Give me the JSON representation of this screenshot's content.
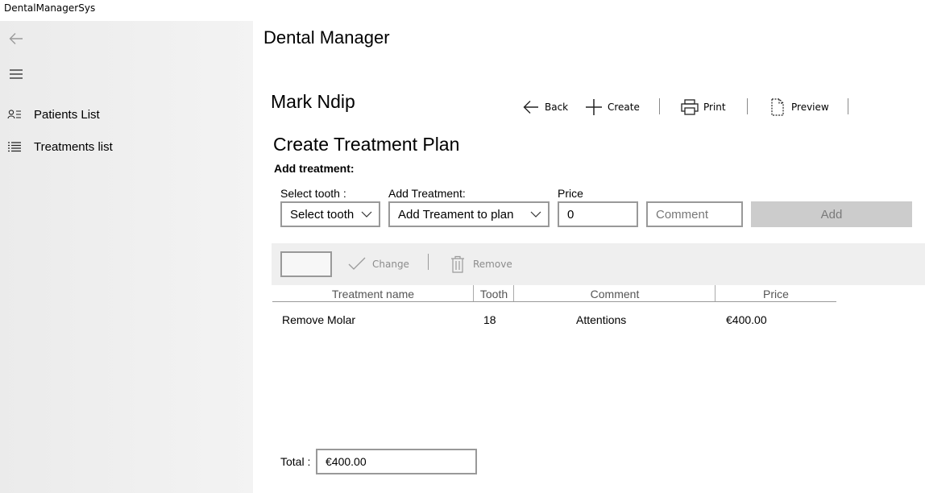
{
  "window": {
    "title": "DentalManagerSys"
  },
  "nav": {
    "back_icon": "arrow-left-icon",
    "menu_icon": "hamburger-icon",
    "items": [
      {
        "label": "Patients List",
        "icon": "contact-list-icon"
      },
      {
        "label": "Treatments list",
        "icon": "bulleted-list-icon"
      }
    ]
  },
  "header": {
    "app_title": "Dental Manager",
    "patient_name": "Mark Ndip"
  },
  "commands": {
    "back": "Back",
    "create": "Create",
    "print": "Print",
    "preview": "Preview"
  },
  "form": {
    "section_title": "Create Treatment Plan",
    "subtitle": "Add treatment:",
    "tooth_label": "Select tooth :",
    "tooth_value": "Select tooth",
    "treatment_label": "Add Treatment:",
    "treatment_value": "Add Treament to plan",
    "price_label": "Price",
    "price_value": "0",
    "comment_placeholder": "Comment",
    "add_label": "Add"
  },
  "grid_toolbar": {
    "change_label": "Change",
    "remove_label": "Remove"
  },
  "table": {
    "headers": [
      "Treatment name",
      "Tooth",
      "Comment",
      "Price"
    ],
    "rows": [
      [
        "Remove Molar",
        "18",
        "Attentions",
        "€400.00"
      ]
    ]
  },
  "footer": {
    "total_label": "Total :",
    "total_value": "€400.00"
  },
  "colors": {
    "nav_bg": "#f0f0f0",
    "disabled_button": "#cccccc",
    "toolbar_bg": "#efefef"
  }
}
